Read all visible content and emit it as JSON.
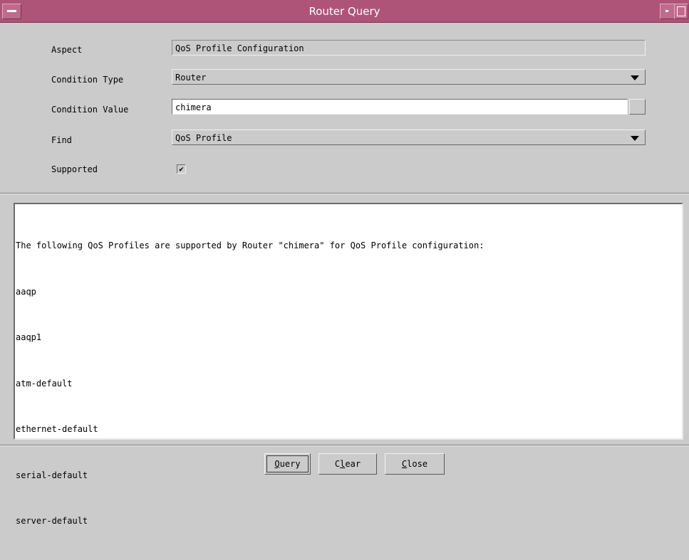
{
  "window": {
    "title": "Router Query"
  },
  "form": {
    "aspect_label": "Aspect",
    "aspect_value": "QoS Profile Configuration",
    "condition_type_label": "Condition Type",
    "condition_type_value": "Router",
    "condition_value_label": "Condition Value",
    "condition_value_value": "chimera",
    "find_label": "Find",
    "find_value": "QoS Profile",
    "supported_label": "Supported",
    "supported_checked": true,
    "supported_mark": "✔"
  },
  "results": {
    "lines": [
      "The following QoS Profiles are supported by Router \"chimera\" for QoS Profile configuration:",
      "aaqp",
      "aaqp1",
      "atm-default",
      "ethernet-default",
      "serial-default",
      "server-default"
    ]
  },
  "buttons": {
    "query": {
      "mnemonic": "Q",
      "rest": "uery"
    },
    "clear": {
      "pre": "C",
      "mnemonic": "l",
      "rest": "ear"
    },
    "close": {
      "mnemonic": "C",
      "rest": "lose"
    }
  },
  "icons": {
    "window_menu": "window-menu-icon",
    "minimize": "minimize-icon",
    "maximize": "maximize-icon",
    "dropdown": "chevron-down-icon",
    "check": "checkmark-icon"
  },
  "colors": {
    "titlebar": "#ad5478",
    "background": "#cbcbcb"
  }
}
